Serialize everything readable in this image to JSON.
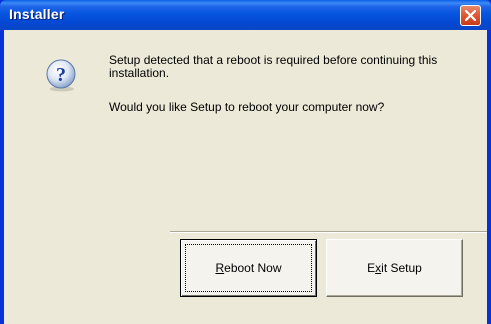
{
  "window": {
    "title": "Installer",
    "close_icon": "close-icon"
  },
  "dialog": {
    "icon": "question-icon",
    "message_line1": "Setup detected that a reboot is required before continuing this installation.",
    "message_line2": "Would you like Setup to reboot your computer now?"
  },
  "buttons": {
    "reboot": {
      "label": "Reboot Now",
      "mnemonic": "R",
      "rest": "eboot Now"
    },
    "exit": {
      "label": "Exit Setup",
      "pre": "E",
      "mnemonic": "x",
      "rest": "it Setup"
    }
  },
  "colors": {
    "titlebar": "#0054e3",
    "client_bg": "#ece9d8",
    "close_button": "#df5a38"
  }
}
